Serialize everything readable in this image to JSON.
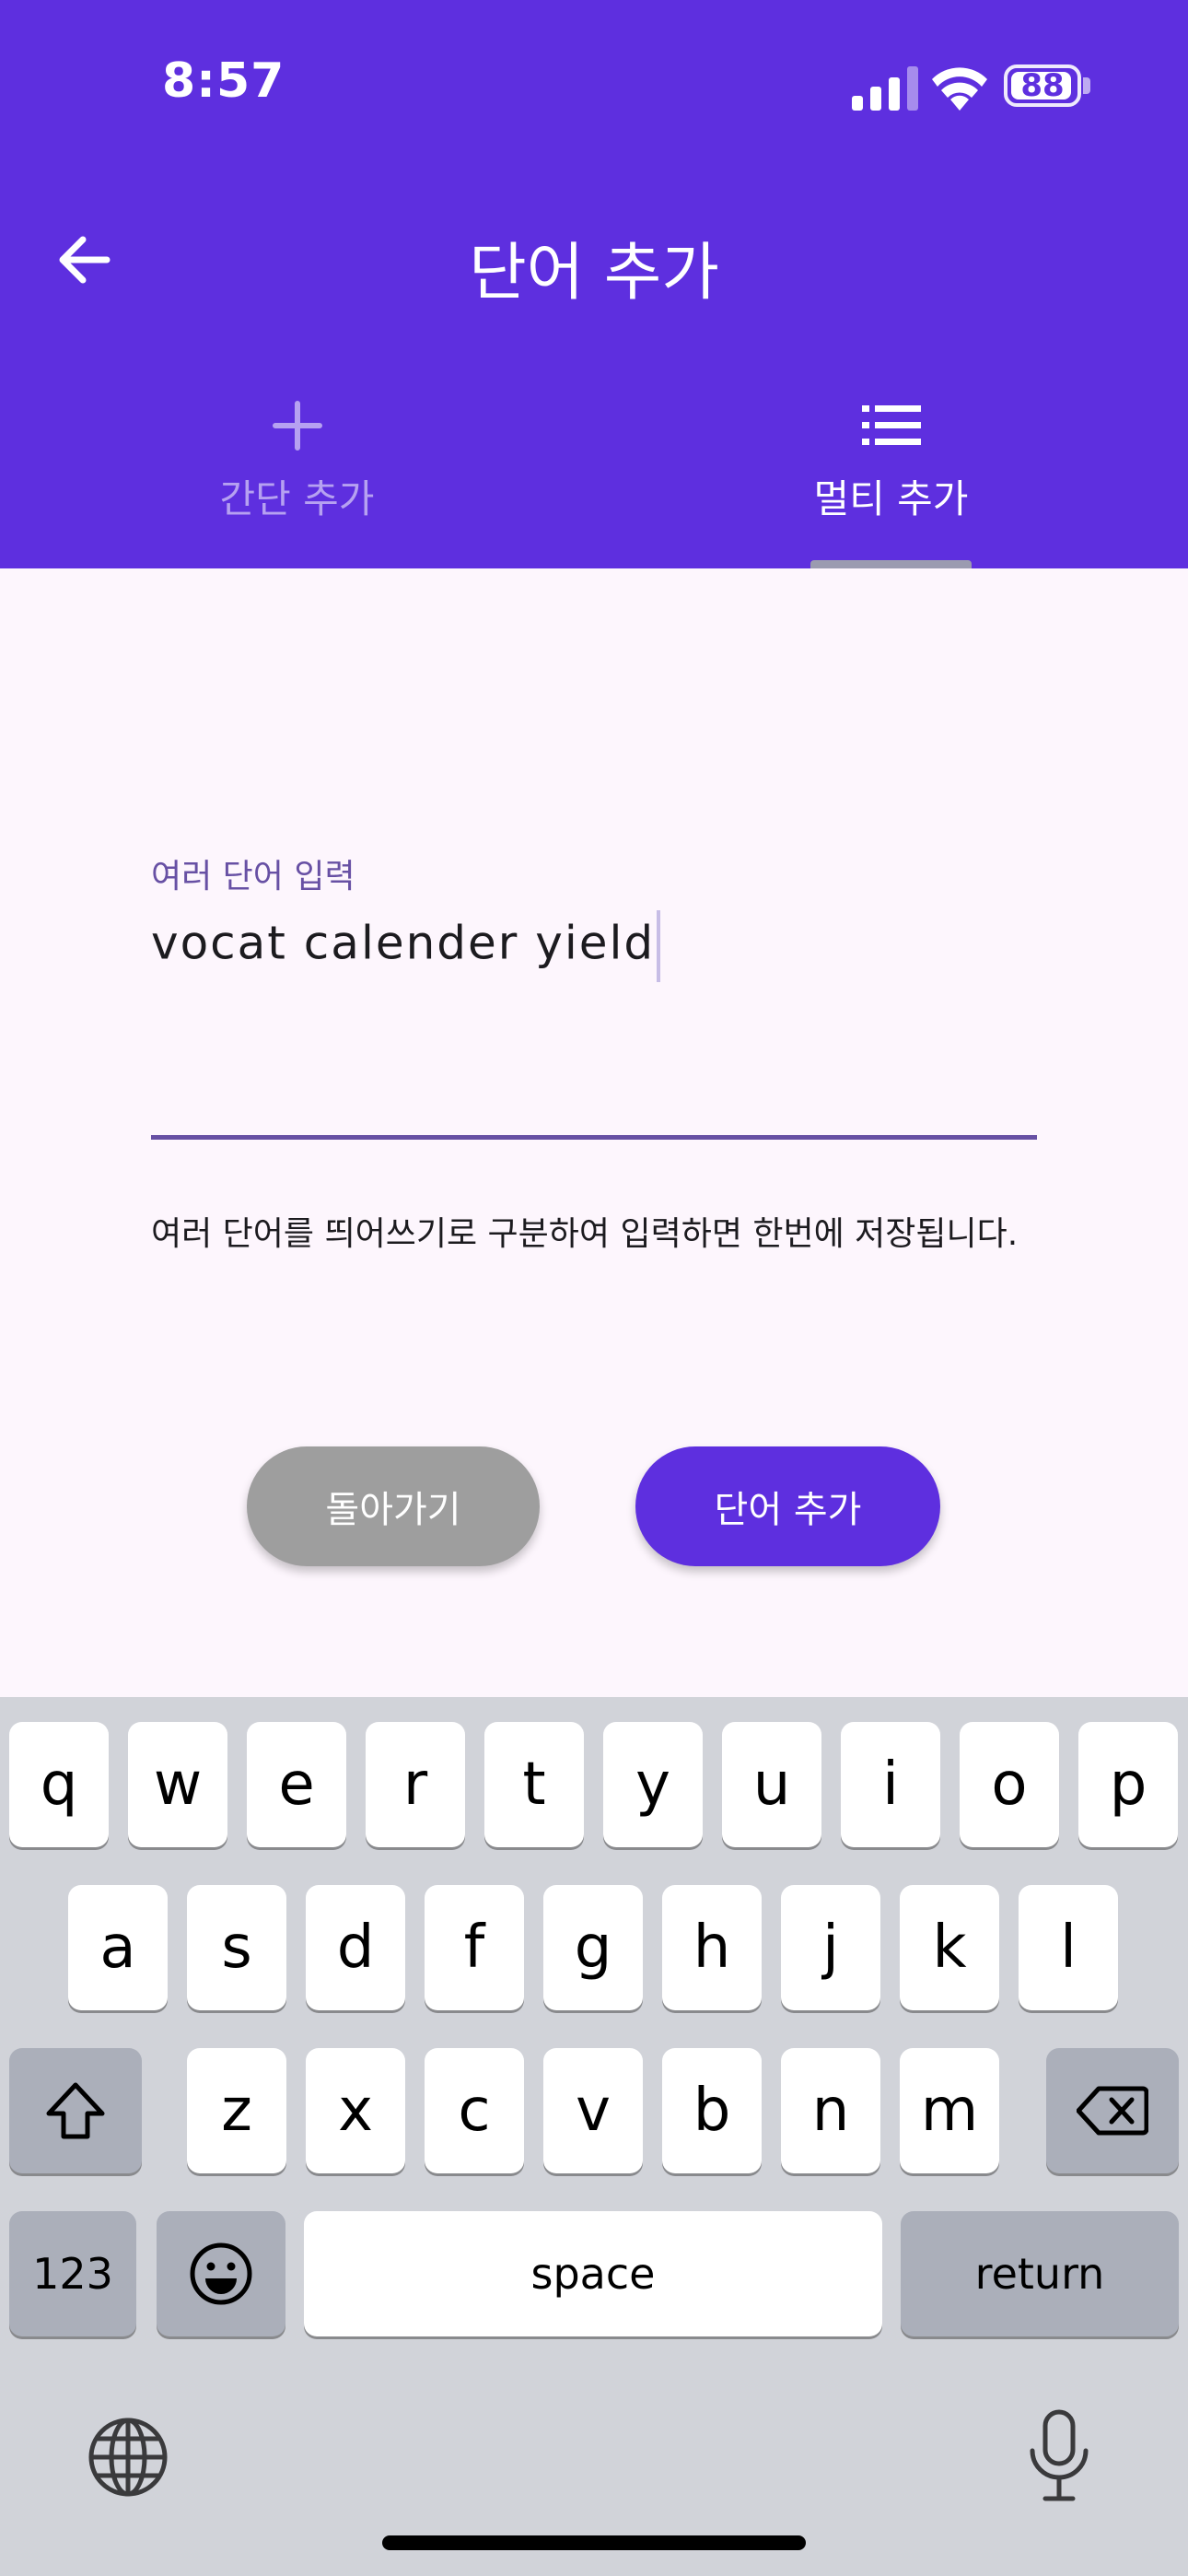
{
  "status_bar": {
    "time": "8:57",
    "battery": "88"
  },
  "header": {
    "title": "단어 추가"
  },
  "tabs": [
    {
      "label": "간단 추가",
      "icon": "plus-icon",
      "selected": false
    },
    {
      "label": "멀티 추가",
      "icon": "list-icon",
      "selected": true
    }
  ],
  "form": {
    "label": "여러 단어 입력",
    "value": "vocat calender yield",
    "helper": "여러 단어를 띄어쓰기로 구분하여 입력하면 한번에 저장됩니다."
  },
  "buttons": {
    "back_label": "돌아가기",
    "add_label": "단어 추가"
  },
  "keyboard": {
    "row1": [
      "q",
      "w",
      "e",
      "r",
      "t",
      "y",
      "u",
      "i",
      "o",
      "p"
    ],
    "row2": [
      "a",
      "s",
      "d",
      "f",
      "g",
      "h",
      "j",
      "k",
      "l"
    ],
    "row3": [
      "z",
      "x",
      "c",
      "v",
      "b",
      "n",
      "m"
    ],
    "numbers_label": "123",
    "space_label": "space",
    "return_label": "return"
  },
  "colors": {
    "primary": "#5e2fdf",
    "accent": "#6750a4",
    "background": "#fdf6fd",
    "button_gray": "#9e9e9e"
  }
}
